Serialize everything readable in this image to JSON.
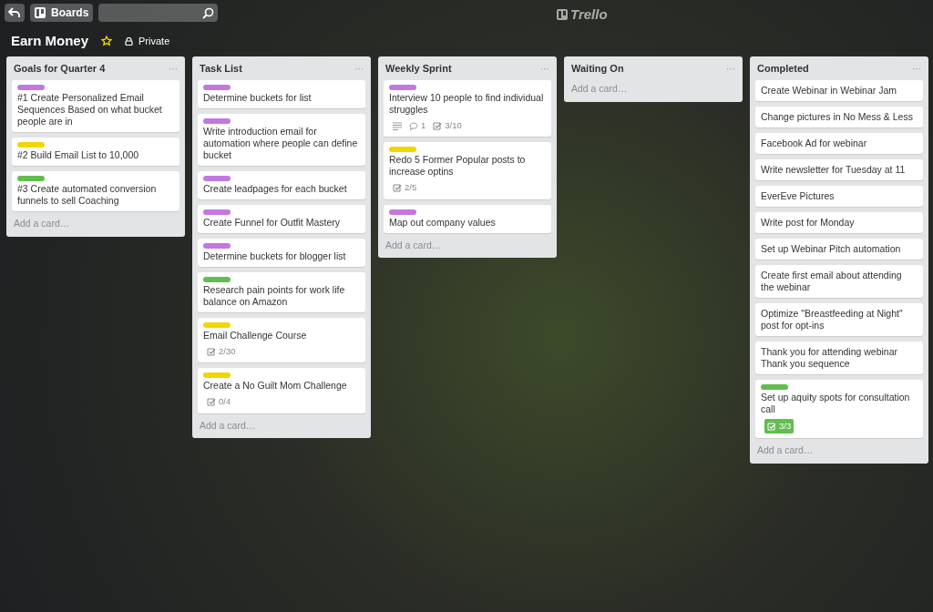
{
  "header": {
    "boards_label": "Boards",
    "logo": "Trello"
  },
  "board": {
    "title": "Earn Money",
    "starred": true,
    "visibility": "Private"
  },
  "lists": [
    {
      "title": "Goals for Quarter 4",
      "menu": "···",
      "add_card": "Add a card…",
      "cards": [
        {
          "labels": [
            {
              "color": "#c377e0"
            }
          ],
          "title": "#1 Create Personalized Email Sequences Based on what bucket people are in"
        },
        {
          "labels": [
            {
              "color": "#f2d600"
            }
          ],
          "title": "#2 Build Email List to 10,000"
        },
        {
          "labels": [
            {
              "color": "#61bd4f"
            }
          ],
          "title": "#3 Create automated conversion funnels to sell Coaching"
        }
      ]
    },
    {
      "title": "Task List",
      "menu": "···",
      "add_card": "Add a card…",
      "cards": [
        {
          "labels": [
            {
              "color": "#c377e0"
            }
          ],
          "title": "Determine buckets for list"
        },
        {
          "labels": [
            {
              "color": "#c377e0"
            }
          ],
          "title": "Write introduction email for automation where people can define bucket"
        },
        {
          "labels": [
            {
              "color": "#c377e0"
            }
          ],
          "title": "Create leadpages for each bucket"
        },
        {
          "labels": [
            {
              "color": "#c377e0"
            }
          ],
          "title": "Create Funnel for Outfit Mastery"
        },
        {
          "labels": [
            {
              "color": "#c377e0"
            }
          ],
          "title": "Determine buckets for blogger list"
        },
        {
          "labels": [
            {
              "color": "#61bd4f"
            }
          ],
          "title": "Research pain points for work life balance on Amazon"
        },
        {
          "labels": [
            {
              "color": "#f2d600"
            }
          ],
          "title": "Email Challenge Course",
          "badges": [
            {
              "kind": "checklist",
              "text": "2/30",
              "complete": false
            }
          ]
        },
        {
          "labels": [
            {
              "color": "#f2d600"
            }
          ],
          "title": "Create a No Guilt Mom Challenge",
          "badges": [
            {
              "kind": "checklist",
              "text": "0/4",
              "complete": false
            }
          ]
        }
      ]
    },
    {
      "title": "Weekly Sprint",
      "menu": "···",
      "add_card": "Add a card…",
      "cards": [
        {
          "labels": [
            {
              "color": "#c377e0"
            }
          ],
          "title": "Interview 10 people to find individual struggles",
          "badges": [
            {
              "kind": "description"
            },
            {
              "kind": "comments",
              "text": "1"
            },
            {
              "kind": "checklist",
              "text": "3/10",
              "complete": false
            }
          ]
        },
        {
          "labels": [
            {
              "color": "#f2d600"
            }
          ],
          "title": "Redo 5 Former Popular posts to increase optins",
          "badges": [
            {
              "kind": "checklist",
              "text": "2/5",
              "complete": false
            }
          ]
        },
        {
          "labels": [
            {
              "color": "#c377e0"
            }
          ],
          "title": "Map out company values"
        }
      ]
    },
    {
      "title": "Waiting On",
      "menu": "···",
      "add_card": "Add a card…"
    },
    {
      "title": "Completed",
      "menu": "···",
      "add_card": "Add a card…",
      "cards": [
        {
          "title": "Create Webinar in Webinar Jam"
        },
        {
          "title": "Change pictures in No Mess & Less"
        },
        {
          "title": "Facebook Ad for webinar"
        },
        {
          "title": "Write newsletter for Tuesday at 11"
        },
        {
          "title": "EverEve Pictures"
        },
        {
          "title": "Write post for Monday"
        },
        {
          "title": "Set up Webinar Pitch automation"
        },
        {
          "title": "Create first email about attending the webinar"
        },
        {
          "title": "Optimize \"Breastfeeding at Night\" post for opt-ins"
        },
        {
          "title": "Thank you for attending webinar Thank you sequence"
        },
        {
          "labels": [
            {
              "color": "#61bd4f"
            }
          ],
          "title": "Set up aquity spots for consultation call",
          "badges": [
            {
              "kind": "checklist",
              "text": "3/3",
              "complete": true
            }
          ]
        }
      ]
    }
  ]
}
